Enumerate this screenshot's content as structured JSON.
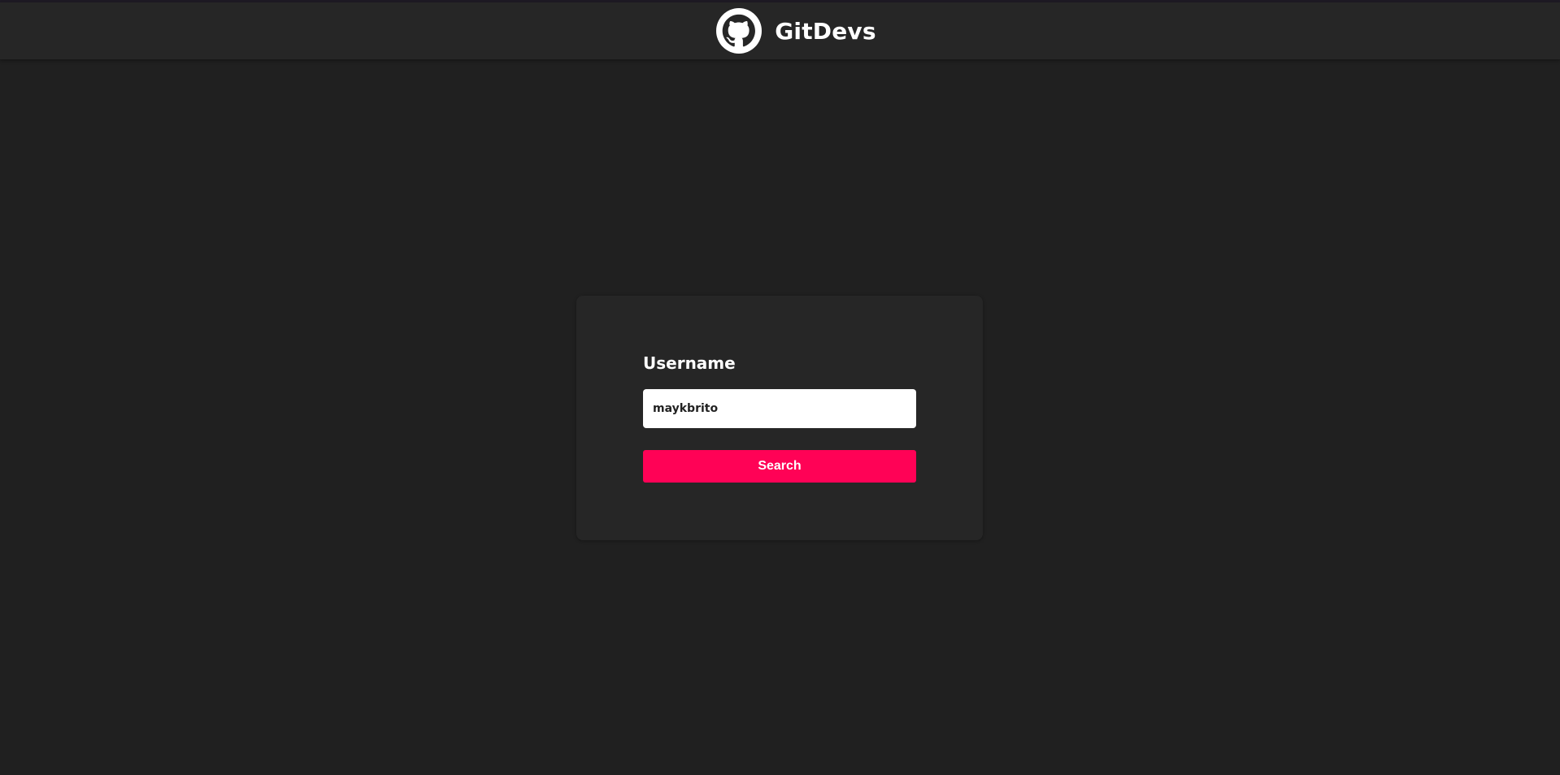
{
  "header": {
    "app_name": "GitDevs",
    "logo_icon": "github-icon"
  },
  "form": {
    "username_label": "Username",
    "username_value": "maykbrito",
    "search_label": "Search"
  },
  "colors": {
    "background": "#202020",
    "header": "#262626",
    "card": "#262626",
    "accent": "#ff0256",
    "text": "#ffffff"
  }
}
